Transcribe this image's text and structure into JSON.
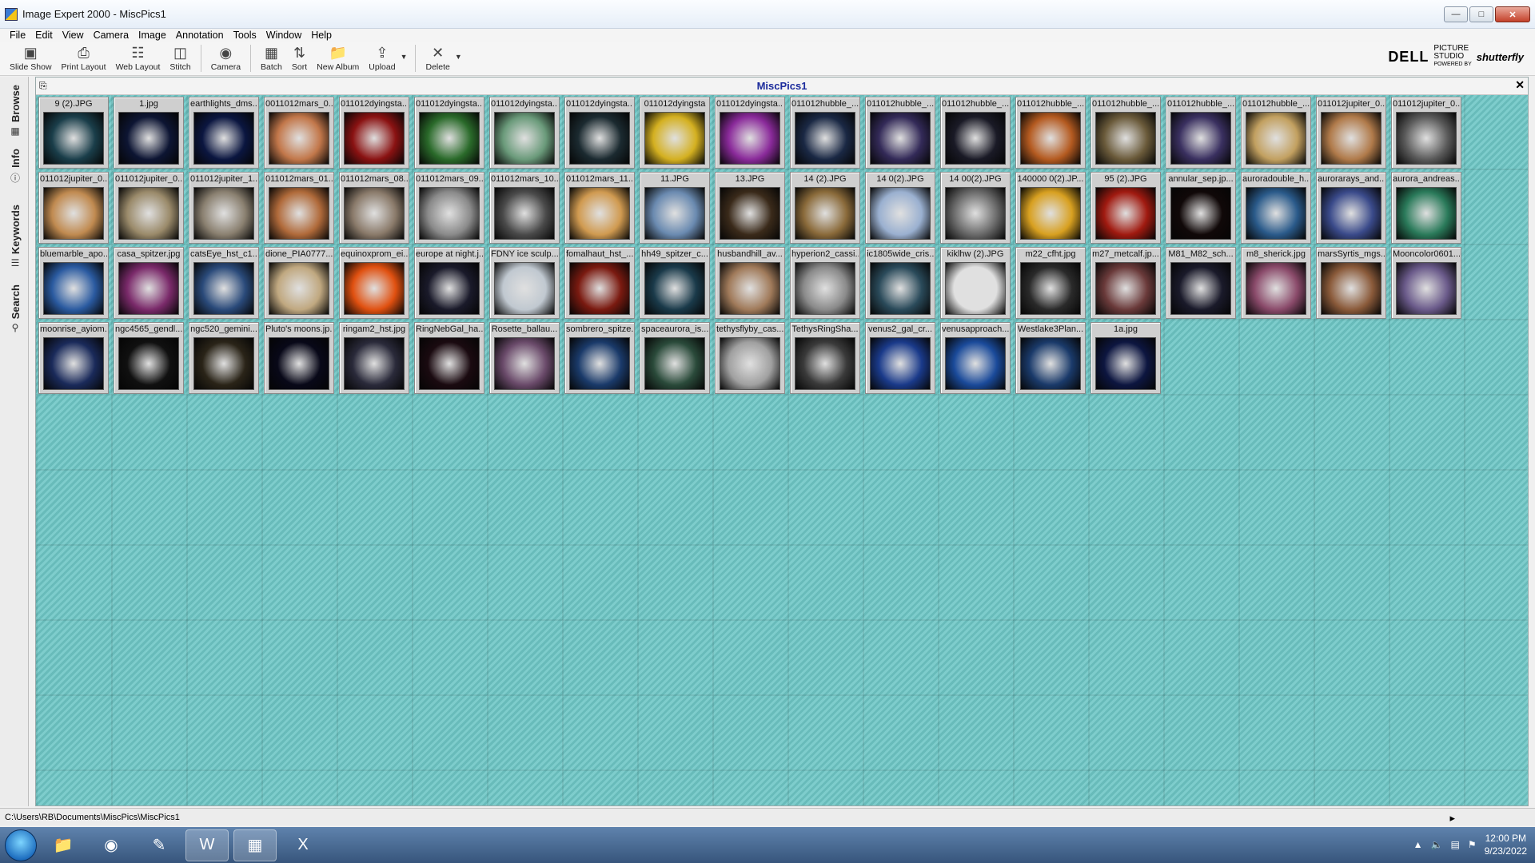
{
  "window": {
    "title": "Image Expert 2000 - MiscPics1"
  },
  "menu": [
    {
      "label": "File",
      "key": "F"
    },
    {
      "label": "Edit",
      "key": "E"
    },
    {
      "label": "View",
      "key": "V"
    },
    {
      "label": "Camera",
      "key": "C"
    },
    {
      "label": "Image",
      "key": "I"
    },
    {
      "label": "Annotation",
      "key": "A"
    },
    {
      "label": "Tools",
      "key": "T"
    },
    {
      "label": "Window",
      "key": "W"
    },
    {
      "label": "Help",
      "key": "H"
    }
  ],
  "toolbar": {
    "slideshow": "Slide Show",
    "print_layout": "Print Layout",
    "web_layout": "Web Layout",
    "stitch": "Stitch",
    "camera": "Camera",
    "batch": "Batch",
    "sort": "Sort",
    "new_album": "New Album",
    "upload": "Upload",
    "delete": "Delete"
  },
  "brand": {
    "dell": "DELL",
    "ps1": "PICTURE",
    "ps2": "STUDIO",
    "powered": "POWERED BY",
    "shutterfly": "shutterfly"
  },
  "sidetabs": [
    "Browse",
    "Info",
    "Keywords",
    "Search"
  ],
  "album": {
    "title": "MiscPics1"
  },
  "thumbnails": [
    {
      "name": "9 (2).JPG",
      "color": "#1a3e4a"
    },
    {
      "name": "1.jpg",
      "color": "#0d1533"
    },
    {
      "name": "earthlights_dms...",
      "color": "#0b1640"
    },
    {
      "name": "0011012mars_0...",
      "color": "#c2774a"
    },
    {
      "name": "011012dyingsta...",
      "color": "#8a1212"
    },
    {
      "name": "011012dyingsta...",
      "color": "#2a6a2a"
    },
    {
      "name": "011012dyingsta...",
      "color": "#6a9a7a"
    },
    {
      "name": "011012dyingsta...",
      "color": "#1b2a30"
    },
    {
      "name": "011012dyingsta",
      "color": "#d4b020"
    },
    {
      "name": "011012dyingsta...",
      "color": "#8a2a9a"
    },
    {
      "name": "011012hubble_...",
      "color": "#1a2844"
    },
    {
      "name": "011012hubble_...",
      "color": "#332a58"
    },
    {
      "name": "011012hubble_...",
      "color": "#1a1a26"
    },
    {
      "name": "011012hubble_...",
      "color": "#b45a20"
    },
    {
      "name": "011012hubble_...",
      "color": "#6a5a3a"
    },
    {
      "name": "011012hubble_...",
      "color": "#3a3060"
    },
    {
      "name": "011012hubble_...",
      "color": "#c2a060"
    },
    {
      "name": "011012jupiter_0...",
      "color": "#b07a4a"
    },
    {
      "name": "011012jupiter_0...",
      "color": "#5a5a5a"
    },
    {
      "name": "011012jupiter_0...",
      "color": "#c08a50"
    },
    {
      "name": "011012jupiter_0...",
      "color": "#9a8a6a"
    },
    {
      "name": "011012jupiter_1...",
      "color": "#8a8070"
    },
    {
      "name": "011012mars_01...",
      "color": "#b06a3a"
    },
    {
      "name": "011012mars_08...",
      "color": "#8a7a6a"
    },
    {
      "name": "011012mars_09...",
      "color": "#8a8a8a"
    },
    {
      "name": "011012mars_10...",
      "color": "#4a4a4a"
    },
    {
      "name": "011012mars_11...",
      "color": "#d09a50"
    },
    {
      "name": "11.JPG",
      "color": "#6a8ab0"
    },
    {
      "name": "13.JPG",
      "color": "#3a2a1a"
    },
    {
      "name": "14 (2).JPG",
      "color": "#8a6a3a"
    },
    {
      "name": "14 0(2).JPG",
      "color": "#9ab0d0"
    },
    {
      "name": "14 00(2).JPG",
      "color": "#6a6a6a"
    },
    {
      "name": "140000 0(2).JP...",
      "color": "#d8a020"
    },
    {
      "name": "95 (2).JPG",
      "color": "#a01a10"
    },
    {
      "name": "annular_sep.jp...",
      "color": "#100808"
    },
    {
      "name": "auroradouble_h...",
      "color": "#2a5a8a"
    },
    {
      "name": "aurorarays_and...",
      "color": "#3a4a8a"
    },
    {
      "name": "aurora_andreas...",
      "color": "#2a7a5a"
    },
    {
      "name": "bluemarble_apo...",
      "color": "#2a5aa0"
    },
    {
      "name": "casa_spitzer.jpg",
      "color": "#7a2a6a"
    },
    {
      "name": "catsEye_hst_c1...",
      "color": "#2a4a7a"
    },
    {
      "name": "dione_PIA0777...",
      "color": "#c0a880"
    },
    {
      "name": "equinoxprom_ei...",
      "color": "#e05010"
    },
    {
      "name": "europe at night.j...",
      "color": "#1a1a2a"
    },
    {
      "name": "FDNY ice sculp...",
      "color": "#c0c8d0"
    },
    {
      "name": "fomalhaut_hst_...",
      "color": "#7a1a10"
    },
    {
      "name": "hh49_spitzer_c...",
      "color": "#1a3a4a"
    },
    {
      "name": "husbandhill_av...",
      "color": "#a07a5a"
    },
    {
      "name": "hyperion2_cassi...",
      "color": "#8a8a8a"
    },
    {
      "name": "ic1805wide_cris...",
      "color": "#2a4a5a"
    },
    {
      "name": "kiklhw (2).JPG",
      "color": "#e0e0e0"
    },
    {
      "name": "m22_cfht.jpg",
      "color": "#2a2a2a"
    },
    {
      "name": "m27_metcalf.jp...",
      "color": "#6a3a3a"
    },
    {
      "name": "M81_M82_sch...",
      "color": "#1a1a2a"
    },
    {
      "name": "m8_sherick.jpg",
      "color": "#8a4a6a"
    },
    {
      "name": "marsSyrtis_mgs...",
      "color": "#8a5a3a"
    },
    {
      "name": "Mooncolor0601...",
      "color": "#6a5a8a"
    },
    {
      "name": "moonrise_ayiom...",
      "color": "#1a2a5a"
    },
    {
      "name": "ngc4565_gendl...",
      "color": "#101010"
    },
    {
      "name": "ngc520_gemini...",
      "color": "#2a2418"
    },
    {
      "name": "Pluto's moons.jp...",
      "color": "#080818"
    },
    {
      "name": "ringam2_hst.jpg",
      "color": "#2a2a3a"
    },
    {
      "name": "RingNebGal_ha...",
      "color": "#1a0a10"
    },
    {
      "name": "Rosette_ballau...",
      "color": "#6a4a6a"
    },
    {
      "name": "sombrero_spitze...",
      "color": "#1a3a6a"
    },
    {
      "name": "spaceaurora_is...",
      "color": "#2a4a3a"
    },
    {
      "name": "tethysflyby_cas...",
      "color": "#a0a0a0"
    },
    {
      "name": "TethysRingSha...",
      "color": "#3a3a3a"
    },
    {
      "name": "venus2_gal_cr...",
      "color": "#1a3a8a"
    },
    {
      "name": "venusapproach...",
      "color": "#1a4a9a"
    },
    {
      "name": "Westlake3Plan...",
      "color": "#1a3a6a"
    },
    {
      "name": "1a.jpg",
      "color": "#0d1640"
    }
  ],
  "status": {
    "path": "C:\\Users\\RB\\Documents\\MiscPics\\MiscPics1"
  },
  "taskbar": {
    "time": "12:00 PM",
    "date": "9/23/2022"
  }
}
